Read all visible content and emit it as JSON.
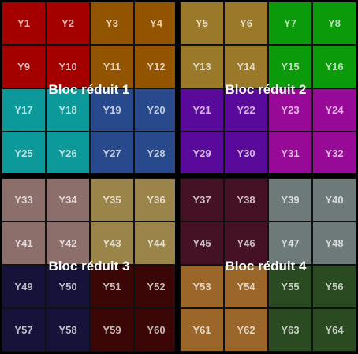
{
  "blocks": [
    {
      "label": "Bloc réduit 1",
      "rows": [
        [
          {
            "id": "Y1",
            "color": "#a40000"
          },
          {
            "id": "Y2",
            "color": "#a40000"
          },
          {
            "id": "Y3",
            "color": "#935400"
          },
          {
            "id": "Y4",
            "color": "#935400"
          }
        ],
        [
          {
            "id": "Y9",
            "color": "#a40000"
          },
          {
            "id": "Y10",
            "color": "#a40000"
          },
          {
            "id": "Y11",
            "color": "#935400"
          },
          {
            "id": "Y12",
            "color": "#935400"
          }
        ],
        [
          {
            "id": "Y17",
            "color": "#0c9999"
          },
          {
            "id": "Y18",
            "color": "#0c9999"
          },
          {
            "id": "Y19",
            "color": "#284a8c"
          },
          {
            "id": "Y20",
            "color": "#284a8c"
          }
        ],
        [
          {
            "id": "Y25",
            "color": "#0c9999"
          },
          {
            "id": "Y26",
            "color": "#0c9999"
          },
          {
            "id": "Y27",
            "color": "#284a8c"
          },
          {
            "id": "Y28",
            "color": "#284a8c"
          }
        ]
      ]
    },
    {
      "label": "Bloc réduit 2",
      "rows": [
        [
          {
            "id": "Y5",
            "color": "#9a7a2a"
          },
          {
            "id": "Y6",
            "color": "#9a7a2a"
          },
          {
            "id": "Y7",
            "color": "#0a9a0a"
          },
          {
            "id": "Y8",
            "color": "#0a9a0a"
          }
        ],
        [
          {
            "id": "Y13",
            "color": "#9a7a2a"
          },
          {
            "id": "Y14",
            "color": "#9a7a2a"
          },
          {
            "id": "Y15",
            "color": "#0a9a0a"
          },
          {
            "id": "Y16",
            "color": "#0a9a0a"
          }
        ],
        [
          {
            "id": "Y21",
            "color": "#5a0a9a"
          },
          {
            "id": "Y22",
            "color": "#5a0a9a"
          },
          {
            "id": "Y23",
            "color": "#970997"
          },
          {
            "id": "Y24",
            "color": "#970997"
          }
        ],
        [
          {
            "id": "Y29",
            "color": "#5a0a9a"
          },
          {
            "id": "Y30",
            "color": "#5a0a9a"
          },
          {
            "id": "Y31",
            "color": "#970997"
          },
          {
            "id": "Y32",
            "color": "#970997"
          }
        ]
      ]
    },
    {
      "label": "Bloc réduit 3",
      "rows": [
        [
          {
            "id": "Y33",
            "color": "#8c6e6a"
          },
          {
            "id": "Y34",
            "color": "#8c6e6a"
          },
          {
            "id": "Y35",
            "color": "#9a844a"
          },
          {
            "id": "Y36",
            "color": "#9a844a"
          }
        ],
        [
          {
            "id": "Y41",
            "color": "#8c6e6a"
          },
          {
            "id": "Y42",
            "color": "#8c6e6a"
          },
          {
            "id": "Y43",
            "color": "#9a844a"
          },
          {
            "id": "Y44",
            "color": "#9a844a"
          }
        ],
        [
          {
            "id": "Y49",
            "color": "#16123a"
          },
          {
            "id": "Y50",
            "color": "#16123a"
          },
          {
            "id": "Y51",
            "color": "#3a0606"
          },
          {
            "id": "Y52",
            "color": "#3a0606"
          }
        ],
        [
          {
            "id": "Y57",
            "color": "#16123a"
          },
          {
            "id": "Y58",
            "color": "#16123a"
          },
          {
            "id": "Y59",
            "color": "#3a0606"
          },
          {
            "id": "Y60",
            "color": "#3a0606"
          }
        ]
      ]
    },
    {
      "label": "Bloc réduit 4",
      "rows": [
        [
          {
            "id": "Y37",
            "color": "#441224"
          },
          {
            "id": "Y38",
            "color": "#441224"
          },
          {
            "id": "Y39",
            "color": "#6e7a7a"
          },
          {
            "id": "Y40",
            "color": "#6e7a7a"
          }
        ],
        [
          {
            "id": "Y45",
            "color": "#441224"
          },
          {
            "id": "Y46",
            "color": "#441224"
          },
          {
            "id": "Y47",
            "color": "#6e7a7a"
          },
          {
            "id": "Y48",
            "color": "#6e7a7a"
          }
        ],
        [
          {
            "id": "Y53",
            "color": "#9a662a"
          },
          {
            "id": "Y54",
            "color": "#9a662a"
          },
          {
            "id": "Y55",
            "color": "#2a4a22"
          },
          {
            "id": "Y56",
            "color": "#2a4a22"
          }
        ],
        [
          {
            "id": "Y61",
            "color": "#9a662a"
          },
          {
            "id": "Y62",
            "color": "#9a662a"
          },
          {
            "id": "Y63",
            "color": "#2a4a22"
          },
          {
            "id": "Y64",
            "color": "#2a4a22"
          }
        ]
      ]
    }
  ]
}
